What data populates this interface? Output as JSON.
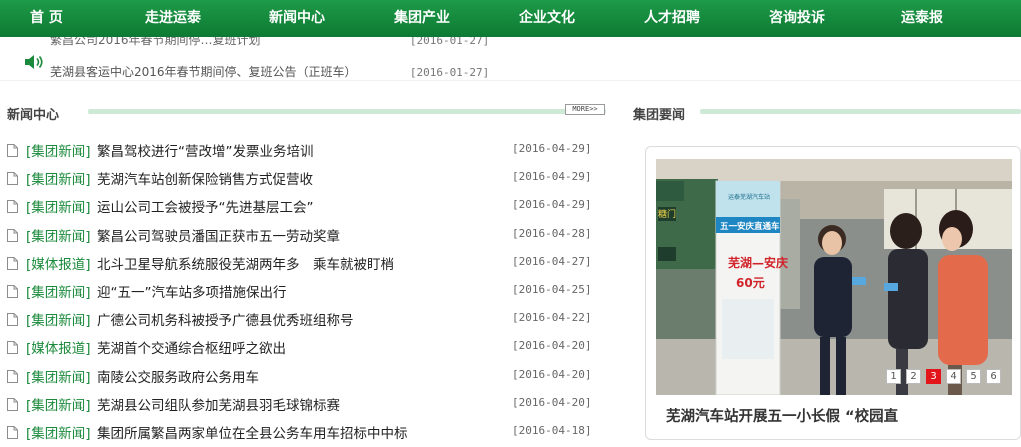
{
  "nav": {
    "items": [
      {
        "label": "首 页",
        "slug": "home"
      },
      {
        "label": "走进运泰",
        "slug": "about"
      },
      {
        "label": "新闻中心",
        "slug": "news"
      },
      {
        "label": "集团产业",
        "slug": "industry"
      },
      {
        "label": "企业文化",
        "slug": "culture"
      },
      {
        "label": "人才招聘",
        "slug": "careers"
      },
      {
        "label": "咨询投诉",
        "slug": "feedback"
      },
      {
        "label": "运泰报",
        "slug": "newspaper"
      }
    ]
  },
  "notices": [
    {
      "title": "繁昌公司2016年春节期间停…复班计划",
      "date": "[2016-01-27]"
    },
    {
      "title": "芜湖县客运中心2016年春节期间停、复班公告（正班车）",
      "date": "[2016-01-27]"
    }
  ],
  "news_section": {
    "title": "新闻中心",
    "more_label": "MORE>>",
    "items": [
      {
        "category": "[集团新闻]",
        "headline": "繁昌驾校进行“营改增”发票业务培训",
        "date": "[2016-04-29]"
      },
      {
        "category": "[集团新闻]",
        "headline": "芜湖汽车站创新保险销售方式促营收",
        "date": "[2016-04-29]"
      },
      {
        "category": "[集团新闻]",
        "headline": "运山公司工会被授予“先进基层工会”",
        "date": "[2016-04-29]"
      },
      {
        "category": "[集团新闻]",
        "headline": "繁昌公司驾驶员潘国正获市五一劳动奖章",
        "date": "[2016-04-28]"
      },
      {
        "category": "[媒体报道]",
        "headline": "北斗卫星导航系统服役芜湖两年多　乘车就被盯梢",
        "date": "[2016-04-27]"
      },
      {
        "category": "[集团新闻]",
        "headline": "迎“五一”汽车站多项措施保出行",
        "date": "[2016-04-25]"
      },
      {
        "category": "[集团新闻]",
        "headline": "广德公司机务科被授予广德县优秀班组称号",
        "date": "[2016-04-22]"
      },
      {
        "category": "[媒体报道]",
        "headline": "芜湖首个交通综合枢纽呼之欲出",
        "date": "[2016-04-20]"
      },
      {
        "category": "[集团新闻]",
        "headline": "南陵公交服务政府公务用车",
        "date": "[2016-04-20]"
      },
      {
        "category": "[集团新闻]",
        "headline": "芜湖县公司组队参加芜湖县羽毛球锦标赛",
        "date": "[2016-04-20]"
      },
      {
        "category": "[集团新闻]",
        "headline": "集团所属繁昌两家单位在全县公务车用车招标中中标",
        "date": "[2016-04-18]"
      }
    ]
  },
  "group_section": {
    "title": "集团要闻",
    "slide_caption": "芜湖汽车站开展五一小长假 “校园直",
    "slide_image": {
      "banner_top": "运泰芜湖汽车站",
      "banner_mid": "五一安庆直通车",
      "banner_route": "芜湖—安庆",
      "banner_price": "60元",
      "shop_sign": "糖门"
    },
    "pages": [
      "1",
      "2",
      "3",
      "4",
      "5",
      "6"
    ],
    "active_page": 3
  },
  "colors": {
    "nav_green": "#0d7a33",
    "category_green": "#1b8a3c",
    "pager_active": "#e3151b",
    "divider_green": "#cfe9d7"
  }
}
